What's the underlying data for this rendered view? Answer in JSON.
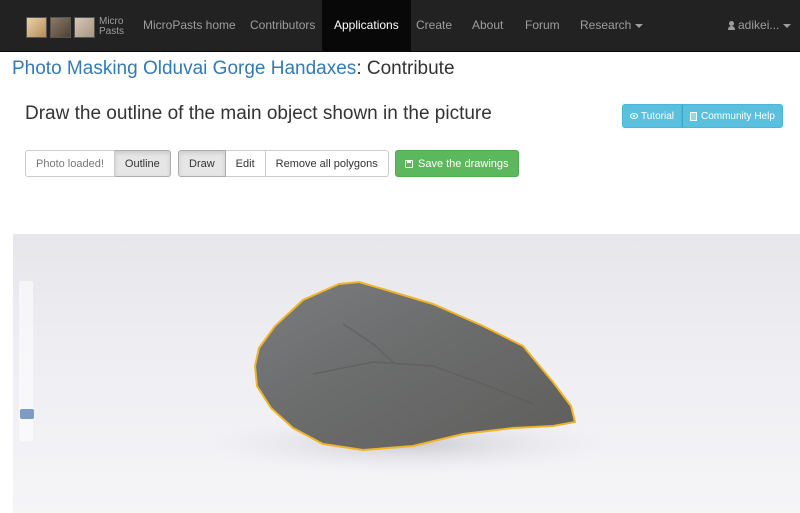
{
  "brand": {
    "line1": "Micro",
    "line2": "Pasts"
  },
  "nav": {
    "home": "MicroPasts home",
    "contributors": "Contributors",
    "applications": "Applications",
    "create": "Create",
    "about": "About",
    "forum": "Forum",
    "research": "Research",
    "user": "adikei..."
  },
  "title": {
    "project": "Photo Masking Olduvai Gorge Handaxes",
    "suffix": ": Contribute"
  },
  "question": "Draw the outline of the main object shown in the picture",
  "help": {
    "tutorial": "Tutorial",
    "community": "Community Help"
  },
  "toolbar": {
    "status": "Photo loaded!",
    "outline": "Outline",
    "draw": "Draw",
    "edit": "Edit",
    "remove": "Remove all polygons",
    "save": "Save the drawings"
  },
  "zoom": {
    "level": 0.15
  },
  "colors": {
    "navbar": "#222222",
    "link": "#337ab7",
    "info": "#5bc0de",
    "success": "#5cb85c",
    "outline": "#f0b429"
  }
}
